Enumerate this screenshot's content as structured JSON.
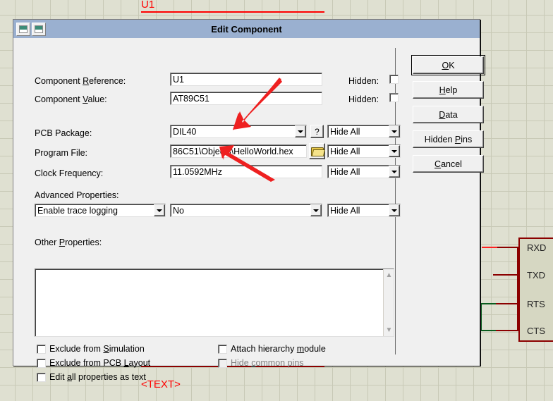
{
  "schematic": {
    "component_label": "U1",
    "text_label": "<TEXT>",
    "pins": [
      "RXD",
      "TXD",
      "RTS",
      "CTS"
    ],
    "wire_colors": {
      "red": "#ff0000",
      "dark_red": "#8b0000",
      "green": "#0a5c1e"
    },
    "background": "#dfe0d1",
    "grid_line": "#c8c9b6"
  },
  "dialog": {
    "title": "Edit Component",
    "titlebar_color": "#9ab0d0",
    "icons": [
      "restore-window-icon",
      "minimize-window-icon"
    ],
    "fields": [
      {
        "label_pre": "Component ",
        "label_key": "R",
        "label_post": "eference:",
        "value": "U1",
        "hidden_label": "Hidden:"
      },
      {
        "label_pre": "Component ",
        "label_key": "V",
        "label_post": "alue:",
        "value": "AT89C51",
        "hidden_label": "Hidden:"
      }
    ],
    "pcb_package": {
      "label_pre": "PCB Packa",
      "label_key": "g",
      "label_post": "e:",
      "value": "DIL40",
      "help_button": "?",
      "visibility": "Hide All"
    },
    "program_file": {
      "label_pre": "Program File:",
      "label_key": "",
      "label_post": "",
      "value": "86C51\\Objects\\HelloWorld.hex",
      "browse_icon": "folder-open-icon",
      "visibility": "Hide All"
    },
    "clock_frequency": {
      "label": "Clock Frequency:",
      "value": "11.0592MHz",
      "visibility": "Hide All"
    },
    "advanced_properties": {
      "label_pre": "Advanced Properties:",
      "property": "Enable trace logging",
      "value": "No",
      "visibility": "Hide All"
    },
    "other_properties": {
      "label_pre": "Other ",
      "label_key": "P",
      "label_post": "roperties:",
      "value": ""
    },
    "checkboxes": [
      {
        "pre": "Exclude from ",
        "key": "S",
        "post": "imulation",
        "checked": false,
        "disabled": false
      },
      {
        "pre": "Exclude from PCB ",
        "key": "L",
        "post": "ayout",
        "checked": false,
        "disabled": false
      },
      {
        "pre": "Edit ",
        "key": "a",
        "post": "ll properties as text",
        "checked": false,
        "disabled": false
      },
      {
        "pre": "Attach hierarchy ",
        "key": "m",
        "post": "odule",
        "checked": false,
        "disabled": false
      },
      {
        "pre": "Hide ",
        "key": "c",
        "post": "ommon pins",
        "checked": false,
        "disabled": true
      }
    ],
    "buttons": [
      {
        "pre": "",
        "key": "O",
        "post": "K",
        "default": true
      },
      {
        "pre": "",
        "key": "H",
        "post": "elp",
        "default": false
      },
      {
        "pre": "",
        "key": "D",
        "post": "ata",
        "default": false
      },
      {
        "pre": "Hidden ",
        "key": "P",
        "post": "ins",
        "default": false
      },
      {
        "pre": "",
        "key": "C",
        "post": "ancel",
        "default": false
      }
    ]
  },
  "annotations": {
    "arrow_color": "#ee2020",
    "arrows": [
      "arrow-to-program-file",
      "arrow-to-clock-frequency"
    ]
  }
}
